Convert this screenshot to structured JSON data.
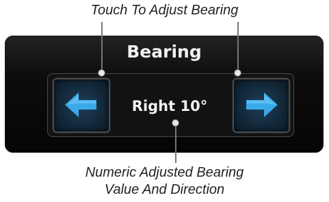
{
  "callouts": {
    "top": "Touch To Adjust Bearing",
    "bottom_line1": "Numeric Adjusted Bearing",
    "bottom_line2": "Value And Direction"
  },
  "panel": {
    "title": "Bearing",
    "value": "Right 10°",
    "left_button_icon": "left-arrow-icon",
    "right_button_icon": "right-arrow-icon"
  },
  "colors": {
    "panel_background": "#0d0d0d",
    "arrow_fill": "#3aa9e8",
    "text": "#f2f2f2",
    "callout_text": "#222222"
  }
}
